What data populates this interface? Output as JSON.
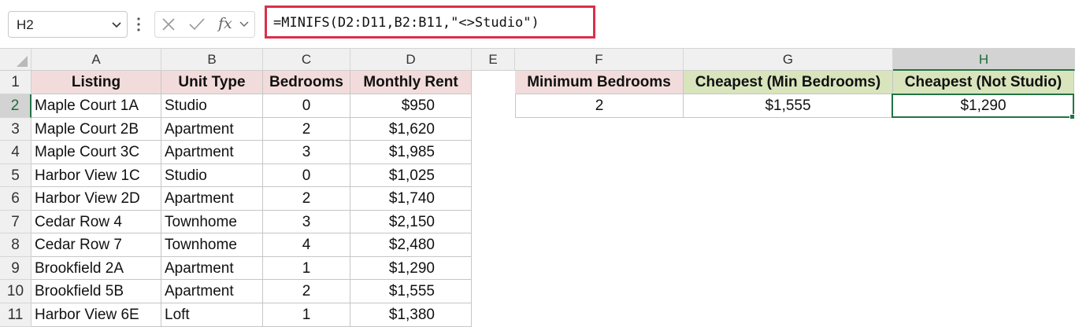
{
  "namebox": {
    "value": "H2"
  },
  "formula_bar": {
    "formula": "=MINIFS(D2:D11,B2:B11,\"<>Studio\")",
    "fx_label": "fx"
  },
  "columns": [
    "A",
    "B",
    "C",
    "D",
    "E",
    "F",
    "G",
    "H"
  ],
  "selected_column": "H",
  "rows": [
    "1",
    "2",
    "3",
    "4",
    "5",
    "6",
    "7",
    "8",
    "9",
    "10",
    "11"
  ],
  "selected_row": "2",
  "table": {
    "headers": [
      "Listing",
      "Unit Type",
      "Bedrooms",
      "Monthly Rent"
    ],
    "data": [
      [
        "Maple Court 1A",
        "Studio",
        "0",
        "$950"
      ],
      [
        "Maple Court 2B",
        "Apartment",
        "2",
        "$1,620"
      ],
      [
        "Maple Court 3C",
        "Apartment",
        "3",
        "$1,985"
      ],
      [
        "Harbor View 1C",
        "Studio",
        "0",
        "$1,025"
      ],
      [
        "Harbor View 2D",
        "Apartment",
        "2",
        "$1,740"
      ],
      [
        "Cedar Row 4",
        "Townhome",
        "3",
        "$2,150"
      ],
      [
        "Cedar Row 7",
        "Townhome",
        "4",
        "$2,480"
      ],
      [
        "Brookfield 2A",
        "Apartment",
        "1",
        "$1,290"
      ],
      [
        "Brookfield 5B",
        "Apartment",
        "2",
        "$1,555"
      ],
      [
        "Harbor View 6E",
        "Loft",
        "1",
        "$1,380"
      ]
    ]
  },
  "summary": {
    "min_bedrooms_header": "Minimum Bedrooms",
    "cheapest_min_header": "Cheapest (Min Bedrooms)",
    "cheapest_not_studio_header": "Cheapest (Not Studio)",
    "min_bedrooms_value": "2",
    "cheapest_min_value": "$1,555",
    "cheapest_not_studio_value": "$1,290"
  },
  "colors": {
    "header_pink": "#f2dcdb",
    "header_green": "#d8e4bc",
    "selection_green": "#217346",
    "formula_highlight": "#d9304a"
  }
}
